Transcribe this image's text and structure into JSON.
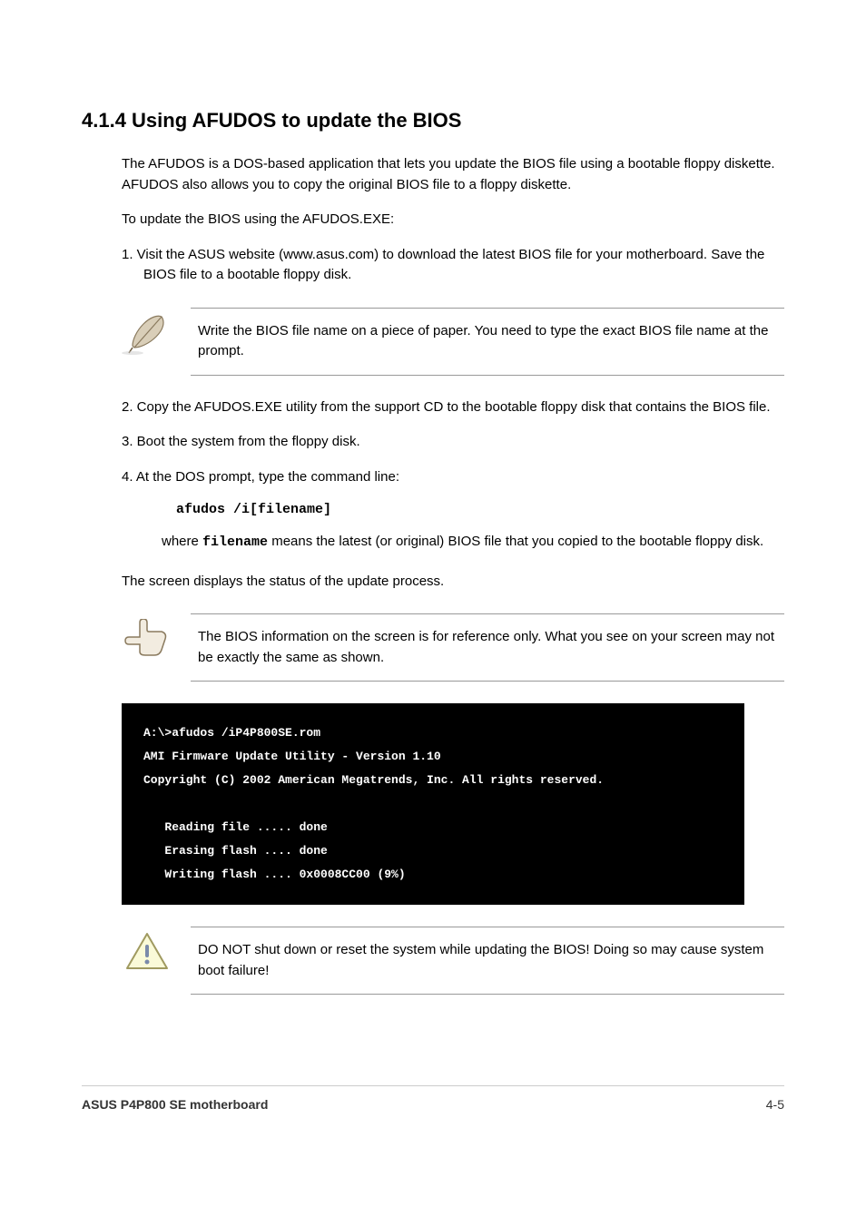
{
  "heading": "4.1.4 Using AFUDOS to update the BIOS",
  "intro": "The AFUDOS is a DOS-based application that lets you update the BIOS file using a bootable floppy diskette. AFUDOS also allows you to copy the original BIOS file to a floppy diskette.",
  "prereq_label": "To update the BIOS using the AFUDOS.EXE:",
  "step1": "1. Visit the ASUS website (www.asus.com) to download the latest BIOS file for your motherboard. Save the BIOS file to a bootable floppy disk.",
  "note1": "Write the BIOS file name on a piece of paper. You need to type the exact BIOS file name at the prompt.",
  "step2": "2. Copy the AFUDOS.EXE utility from the support CD to the bootable floppy disk that contains the BIOS file.",
  "step3": "3. Boot the system from the floppy disk.",
  "step4": "4. At the DOS prompt, type the command line:",
  "cmd": "afudos /i[filename]",
  "filename_desc_prefix": "where ",
  "filename_keyword": "filename",
  "filename_desc_suffix": " means the latest (or original) BIOS file that you copied to the bootable floppy disk.",
  "note2": "The screen displays the status of the update process.",
  "note3": "The BIOS information on the screen is for reference only. What you see on your screen may not be exactly the same as shown.",
  "terminal": {
    "line1": "A:\\>afudos /iP4P800SE.rom",
    "line2": "AMI Firmware Update Utility - Version 1.10",
    "line3": "Copyright (C) 2002 American Megatrends, Inc. All rights reserved.",
    "line4": "   Reading file ..... done",
    "line5": "   Erasing flash .... done",
    "line6": "   Writing flash .... 0x0008CC00 (9%)"
  },
  "warning": "DO NOT shut down or reset the system while updating the BIOS! Doing so may cause system boot failure!",
  "footer": {
    "left": "ASUS P4P800 SE motherboard",
    "right": "4-5"
  }
}
